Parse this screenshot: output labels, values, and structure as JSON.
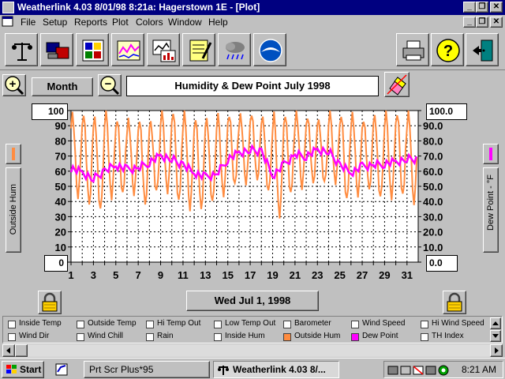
{
  "window": {
    "title": "Weatherlink 4.03   8/01/98   8:21a: Hagerstown 1E - [Plot]",
    "min_glyph": "_",
    "restore_glyph": "❐",
    "close_glyph": "✕"
  },
  "menu": {
    "items": [
      "File",
      "Setup",
      "Reports",
      "Plot",
      "Colors",
      "Window",
      "Help"
    ]
  },
  "controls": {
    "zoom_in_glyph": "+",
    "zoom_out_glyph": "−",
    "period_label": "Month",
    "chart_title": "Humidity & Dew Point  July 1998",
    "date_button": "Wed Jul 1, 1998"
  },
  "left_axis": {
    "top_box": "100",
    "bottom_box": "0",
    "label": "Outside Hum",
    "color": "#ff8c40"
  },
  "right_axis": {
    "top_box": "100.0",
    "bottom_box": "0.0",
    "label": "Dew Point - °F",
    "color": "#ff00ff"
  },
  "legend": {
    "row1": [
      {
        "label": "Inside Temp",
        "checked": false
      },
      {
        "label": "Outside Temp",
        "checked": false
      },
      {
        "label": "Hi Temp Out",
        "checked": false
      },
      {
        "label": "Low Temp Out",
        "checked": false
      },
      {
        "label": "Barometer",
        "checked": false
      },
      {
        "label": "Wind Speed",
        "checked": false
      },
      {
        "label": "Hi Wind Speed",
        "checked": false
      }
    ],
    "row2": [
      {
        "label": "Wind Dir",
        "checked": false
      },
      {
        "label": "Wind Chill",
        "checked": false
      },
      {
        "label": "Rain",
        "checked": false
      },
      {
        "label": "Inside Hum",
        "checked": false
      },
      {
        "label": "Outside Hum",
        "checked": true,
        "color": "#ff8c40"
      },
      {
        "label": "Dew Point",
        "checked": true,
        "color": "#ff00ff"
      },
      {
        "label": "TH Index",
        "checked": false
      }
    ]
  },
  "taskbar": {
    "start_label": "Start",
    "tasks": [
      "Prt Scr Plus*95",
      "Weatherlink 4.03   8/..."
    ],
    "clock": "8:21 AM"
  },
  "chart_data": {
    "type": "line",
    "xlabel": "",
    "ylabel": "Outside Hum",
    "y2label": "Dew Point - °F",
    "ylim": [
      0,
      100
    ],
    "y2lim": [
      0,
      100
    ],
    "xlim": [
      1,
      32
    ],
    "x_ticks": [
      "1",
      "2",
      "3",
      "4",
      "5",
      "6",
      "7",
      "8",
      "9",
      "10",
      "11",
      "12",
      "13",
      "14",
      "15",
      "16",
      "17",
      "18",
      "19",
      "20",
      "21",
      "22",
      "23",
      "24",
      "25",
      "26",
      "27",
      "28",
      "29",
      "30",
      "31"
    ],
    "y_ticks": [
      "0",
      "10",
      "20",
      "30",
      "40",
      "50",
      "60",
      "70",
      "80",
      "90",
      "100"
    ],
    "y2_ticks": [
      "0.0",
      "10.0",
      "20.0",
      "30.0",
      "40.0",
      "50.0",
      "60.0",
      "70.0",
      "80.0",
      "90.0",
      "100.0"
    ],
    "grid": true,
    "series": [
      {
        "name": "Outside Hum",
        "color": "#ff8c40",
        "axis": "left",
        "daily_max": [
          98,
          99,
          96,
          99,
          94,
          94,
          95,
          93,
          99,
          99,
          99,
          96,
          95,
          96,
          97,
          97,
          99,
          96,
          97,
          97,
          99,
          97,
          94,
          98,
          97,
          98,
          95,
          97,
          98,
          98,
          99
        ],
        "daily_min": [
          44,
          38,
          33,
          42,
          45,
          46,
          38,
          45,
          46,
          40,
          36,
          35,
          38,
          44,
          51,
          53,
          54,
          45,
          30,
          45,
          50,
          52,
          51,
          52,
          41,
          45,
          48,
          41,
          42,
          44,
          40
        ]
      },
      {
        "name": "Dew Point",
        "color": "#ff00ff",
        "axis": "right",
        "daily": [
          62,
          59,
          55,
          60,
          64,
          61,
          62,
          66,
          70,
          68,
          64,
          59,
          56,
          58,
          68,
          72,
          74,
          73,
          57,
          64,
          71,
          70,
          74,
          73,
          64,
          59,
          63,
          64,
          65,
          66,
          68
        ]
      }
    ]
  }
}
